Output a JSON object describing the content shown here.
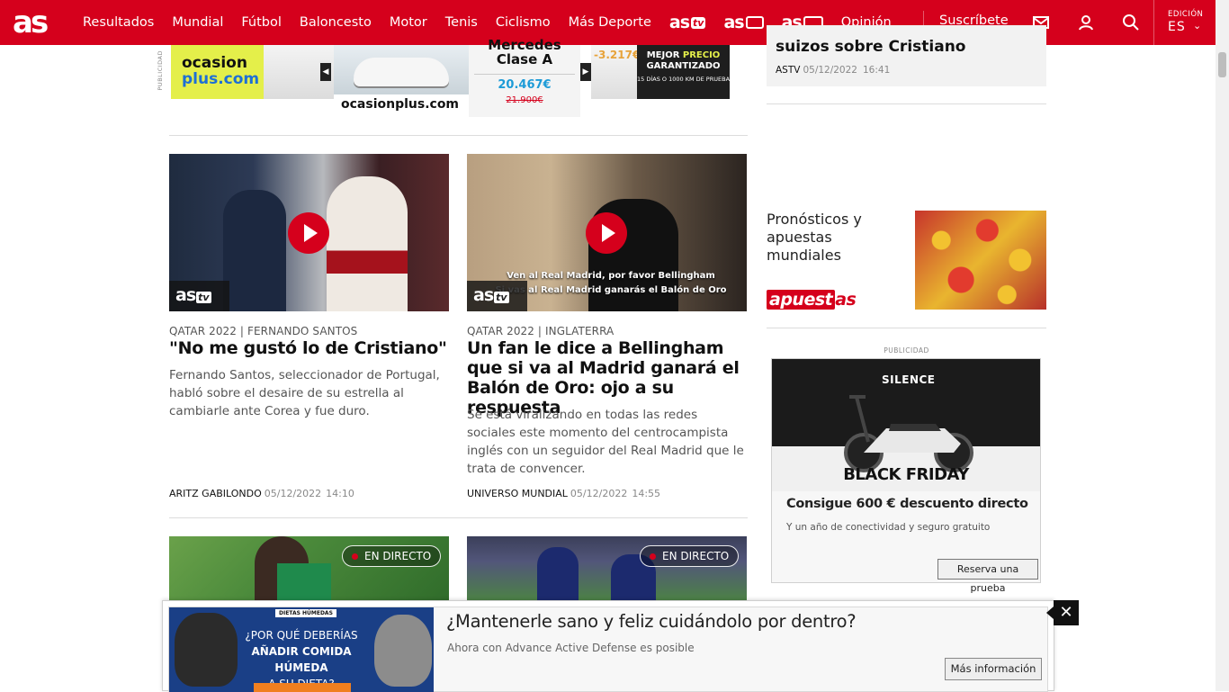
{
  "header": {
    "logo": "as",
    "nav": [
      "Resultados",
      "Mundial",
      "Fútbol",
      "Baloncesto",
      "Motor",
      "Tenis",
      "Ciclismo",
      "Más Deporte"
    ],
    "brands": [
      {
        "main": "as",
        "sub": "tv"
      },
      {
        "main": "as",
        "sub": ""
      },
      {
        "main": "as",
        "sub": ""
      }
    ],
    "opinion": "Opinión",
    "subscribe": "Suscríbete",
    "edition_label": "EDICIÓN",
    "edition_value": "ES",
    "accent": "#d5001c"
  },
  "top_ad": {
    "side_label": "PUBLICIDAD",
    "brand_line1": "ocasion",
    "brand_line2": "plus.com",
    "model_line1": "Mercedes",
    "model_line2": "Clase A",
    "price": "20.467€",
    "old_price": "21.900€",
    "discount": "-3.217€",
    "guarantee_line1": "MEJOR",
    "guarantee_highlight": "PRECIO",
    "guarantee_line2": "GARANTIZADO",
    "guarantee_small": "15 DÍAS O 1000 KM DE PRUEBA",
    "brand_full": "ocasionplus.com"
  },
  "articles": [
    {
      "kicker": "QATAR 2022 | FERNANDO SANTOS",
      "headline": "\"No me gustó lo de Cristiano\"",
      "summary": "Fernando Santos, seleccionador de Portugal, habló sobre el desaire de su estrella al cambiarle ante Corea y fue duro.",
      "author": "ARITZ GABILONDO",
      "date": "05/12/2022",
      "time": "14:10",
      "badge_main": "as",
      "badge_sub": "tv"
    },
    {
      "kicker": "QATAR 2022 | INGLATERRA",
      "headline": "Un fan le dice a Bellingham que si va al Madrid ganará el Balón de Oro: ojo a su respuesta",
      "summary": "Se está viralizando en todas las redes sociales este momento del centrocampista inglés con un seguidor del Real Madrid que le trata de convencer.",
      "author": "UNIVERSO MUNDIAL",
      "date": "05/12/2022",
      "time": "14:55",
      "badge_main": "as",
      "badge_sub": "tv",
      "caption_line1": "Ven al Real Madrid, por favor Bellingham",
      "caption_line2": "Si vas al Real Madrid ganarás el Balón de Oro"
    }
  ],
  "live_label": "EN DIRECTO",
  "sidebar": {
    "top_card_title": "suizos sobre Cristiano",
    "top_card_source": "ASTV",
    "top_card_date": "05/12/2022",
    "top_card_time": "16:41",
    "apuestas_title": "Pronósticos y apuestas mundiales",
    "apuestas_logo_main": "apuest",
    "apuestas_logo_box": "as",
    "pub_label": "PUBLICIDAD",
    "ad_brand": "SILENCE",
    "ad_promo": "BLACK FRIDAY",
    "ad_headline": "Consigue 600 € descuento directo",
    "ad_sub": "Y un año de conectividad y seguro gratuito",
    "ad_button": "Reserva una prueba"
  },
  "sticky_ad": {
    "tag": "DIETAS HÚMEDAS",
    "question_line1": "¿POR QUÉ DEBERÍAS",
    "question_line2": "AÑADIR COMIDA HÚMEDA",
    "question_line3": "A SU DIETA?",
    "headline": "¿Mantenerle sano y feliz cuidándolo por dentro?",
    "sub": "Ahora con Advance Active Defense es posible",
    "button": "Más información",
    "close": "✕"
  }
}
